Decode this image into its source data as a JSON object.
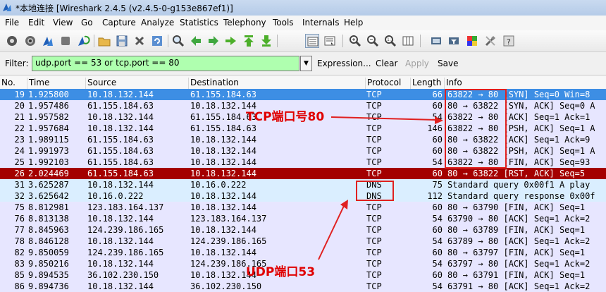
{
  "window": {
    "title": "*本地连接 [Wireshark 2.4.5 (v2.4.5-0-g153e867ef1)]"
  },
  "menu": [
    "File",
    "Edit",
    "View",
    "Go",
    "Capture",
    "Analyze",
    "Statistics",
    "Telephony",
    "Tools",
    "Internals",
    "Help"
  ],
  "toolbar": {
    "icons": [
      "interface-list-icon",
      "capture-options-icon",
      "start-capture-icon",
      "stop-capture-icon",
      "restart-capture-icon",
      "open-file-icon",
      "save-file-icon",
      "close-file-icon",
      "reload-icon",
      "find-packet-icon",
      "go-back-icon",
      "go-forward-icon",
      "go-to-packet-icon",
      "go-first-icon",
      "go-last-icon",
      "colorize-icon",
      "auto-scroll-icon",
      "zoom-in-icon",
      "zoom-out-icon",
      "normal-size-icon",
      "resize-columns-icon",
      "capture-filters-icon",
      "display-filters-icon",
      "coloring-rules-icon",
      "preferences-icon",
      "help-icon"
    ]
  },
  "filter": {
    "label": "Filter:",
    "value": "udp.port == 53 or tcp.port == 80",
    "expression_label": "Expression...",
    "clear_label": "Clear",
    "apply_label": "Apply",
    "save_label": "Save"
  },
  "columns": [
    "No.",
    "Time",
    "Source",
    "Destination",
    "Protocol",
    "Length",
    "Info"
  ],
  "colors": {
    "tcp_row": "#e7e6ff",
    "dns_row": "#daeeff",
    "selected_row": "#3d8ee4",
    "rst_row": "#a40000",
    "annotation": "#e00000",
    "filter_ok": "#afffaf"
  },
  "packets": [
    {
      "no": "19",
      "time": "1.925800",
      "src": "10.18.132.144",
      "dst": "61.155.184.63",
      "proto": "TCP",
      "len": "66",
      "info": "63822 → 80 [SYN] Seq=0 Win=8",
      "style": "selected"
    },
    {
      "no": "20",
      "time": "1.957486",
      "src": "61.155.184.63",
      "dst": "10.18.132.144",
      "proto": "TCP",
      "len": "60",
      "info": "80 → 63822 [SYN, ACK] Seq=0 A",
      "style": "tcp"
    },
    {
      "no": "21",
      "time": "1.957582",
      "src": "10.18.132.144",
      "dst": "61.155.184.63",
      "proto": "TCP",
      "len": "54",
      "info": "63822 → 80 [ACK] Seq=1 Ack=1",
      "style": "tcp"
    },
    {
      "no": "22",
      "time": "1.957684",
      "src": "10.18.132.144",
      "dst": "61.155.184.63",
      "proto": "TCP",
      "len": "146",
      "info": "63822 → 80 [PSH, ACK] Seq=1 A",
      "style": "tcp"
    },
    {
      "no": "23",
      "time": "1.989115",
      "src": "61.155.184.63",
      "dst": "10.18.132.144",
      "proto": "TCP",
      "len": "60",
      "info": "80 → 63822 [ACK] Seq=1 Ack=9",
      "style": "tcp"
    },
    {
      "no": "24",
      "time": "1.991973",
      "src": "61.155.184.63",
      "dst": "10.18.132.144",
      "proto": "TCP",
      "len": "60",
      "info": "80 → 63822 [PSH, ACK] Seq=1 A",
      "style": "tcp"
    },
    {
      "no": "25",
      "time": "1.992103",
      "src": "61.155.184.63",
      "dst": "10.18.132.144",
      "proto": "TCP",
      "len": "54",
      "info": "63822 → 80 [FIN, ACK] Seq=93",
      "style": "tcp"
    },
    {
      "no": "26",
      "time": "2.024469",
      "src": "61.155.184.63",
      "dst": "10.18.132.144",
      "proto": "TCP",
      "len": "60",
      "info": "80 → 63822 [RST, ACK] Seq=5",
      "style": "rst"
    },
    {
      "no": "31",
      "time": "3.625287",
      "src": "10.18.132.144",
      "dst": "10.16.0.222",
      "proto": "DNS",
      "len": "75",
      "info": "Standard query 0x00f1 A play",
      "style": "dns"
    },
    {
      "no": "32",
      "time": "3.625642",
      "src": "10.16.0.222",
      "dst": "10.18.132.144",
      "proto": "DNS",
      "len": "112",
      "info": "Standard query response 0x00f",
      "style": "dns"
    },
    {
      "no": "75",
      "time": "8.812981",
      "src": "123.183.164.137",
      "dst": "10.18.132.144",
      "proto": "TCP",
      "len": "60",
      "info": "80 → 63790 [FIN, ACK] Seq=1",
      "style": "tcp"
    },
    {
      "no": "76",
      "time": "8.813138",
      "src": "10.18.132.144",
      "dst": "123.183.164.137",
      "proto": "TCP",
      "len": "54",
      "info": "63790 → 80 [ACK] Seq=1 Ack=2",
      "style": "tcp"
    },
    {
      "no": "77",
      "time": "8.845963",
      "src": "124.239.186.165",
      "dst": "10.18.132.144",
      "proto": "TCP",
      "len": "60",
      "info": "80 → 63789 [FIN, ACK] Seq=1",
      "style": "tcp"
    },
    {
      "no": "78",
      "time": "8.846128",
      "src": "10.18.132.144",
      "dst": "124.239.186.165",
      "proto": "TCP",
      "len": "54",
      "info": "63789 → 80 [ACK] Seq=1 Ack=2",
      "style": "tcp"
    },
    {
      "no": "82",
      "time": "9.850059",
      "src": "124.239.186.165",
      "dst": "10.18.132.144",
      "proto": "TCP",
      "len": "60",
      "info": "80 → 63797 [FIN, ACK] Seq=1",
      "style": "tcp"
    },
    {
      "no": "83",
      "time": "9.850216",
      "src": "10.18.132.144",
      "dst": "124.239.186.165",
      "proto": "TCP",
      "len": "54",
      "info": "63797 → 80 [ACK] Seq=1 Ack=2",
      "style": "tcp"
    },
    {
      "no": "85",
      "time": "9.894535",
      "src": "36.102.230.150",
      "dst": "10.18.132.144",
      "proto": "TCP",
      "len": "60",
      "info": "80 → 63791 [FIN, ACK] Seq=1",
      "style": "tcp"
    },
    {
      "no": "86",
      "time": "9.894736",
      "src": "10.18.132.144",
      "dst": "36.102.230.150",
      "proto": "TCP",
      "len": "54",
      "info": "63791 → 80 [ACK] Seq=1 Ack=2",
      "style": "tcp"
    }
  ],
  "annotations": {
    "tcp_label": "TCP端口号80",
    "udp_label": "UDP端口53"
  }
}
